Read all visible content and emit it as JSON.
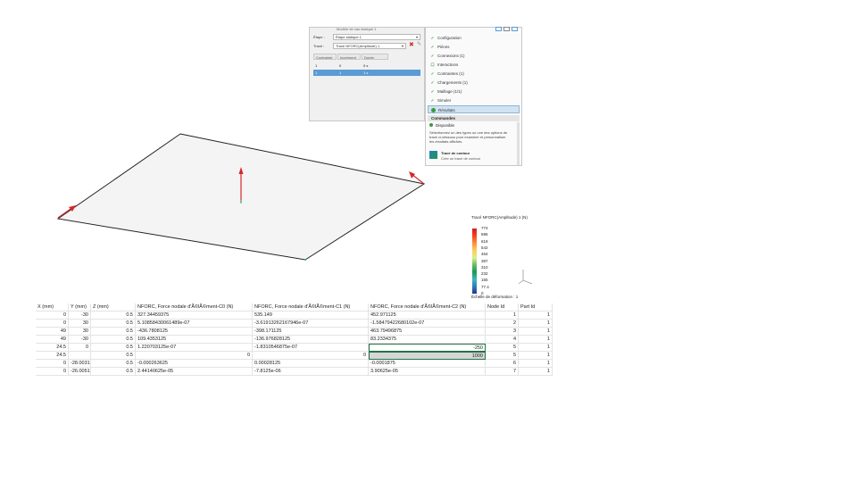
{
  "sim_panel": {
    "top_text": "Modèle de cas statique 1",
    "etape_label": "Étape :",
    "etape_value": "Étape statique 1",
    "trace_label": "Tracé :",
    "trace_value": "Tracé NFORC(Amplitude) 1",
    "col_headers": [
      "Contrainte",
      "Incrément",
      "Durée"
    ],
    "rows": [
      [
        "1",
        "0",
        "0 s"
      ],
      [
        "1",
        "1",
        "1 s"
      ]
    ]
  },
  "workflow": {
    "items": [
      {
        "label": "Configuration",
        "icon": "check-icon"
      },
      {
        "label": "Pièces",
        "icon": "check-icon"
      },
      {
        "label": "Connexions (1)",
        "icon": "check-icon"
      },
      {
        "label": "Interactions",
        "icon": "empty-box-icon"
      },
      {
        "label": "Contraintes (1)",
        "icon": "check-icon"
      },
      {
        "label": "Chargements (1)",
        "icon": "check-icon"
      },
      {
        "label": "Maillage (1/1)",
        "icon": "check-icon"
      },
      {
        "label": "Simuler",
        "icon": "check-icon"
      },
      {
        "label": "Résultats",
        "icon": "green-dot-icon"
      }
    ],
    "commands_header": "Commandes",
    "status": "Disponible",
    "description": "Sélectionnez un des types ou une des options de tracé ci-dessous pour examiner et personnaliser les résultats affichés.",
    "contour_title": "Tracé de contour",
    "contour_sub": "Crée un tracé de contour"
  },
  "legend": {
    "title": "Tracé NFORC(Amplitude) 1 (N)",
    "ticks": [
      "774",
      "696",
      "619",
      "542",
      "464",
      "387",
      "310",
      "232",
      "155",
      "77.4",
      "0"
    ],
    "footer": "Échelle de déformation : 1"
  },
  "sheet": {
    "headers": [
      "X (mm)",
      "Y (mm)",
      "Z (mm)",
      "NFORC, Force nodale d'Ã©lÃ©ment-C0 (N)",
      "NFORC, Force nodale d'Ã©lÃ©ment-C1 (N)",
      "NFORC, Force nodale d'Ã©lÃ©ment-C2 (N)",
      "Node Id",
      "Part Id"
    ],
    "rows": [
      [
        "0",
        "-30",
        "0.5",
        "327.34459375",
        "535.149",
        "452.971125",
        "1",
        "1"
      ],
      [
        "0",
        "30",
        "0.5",
        "5.10858430061489e-07",
        "-3.61913262167946e-07",
        "-1.58479422680102e-07",
        "2",
        "1"
      ],
      [
        "49",
        "30",
        "0.5",
        "-436.7808125",
        "-398.171125",
        "463.79496875",
        "3",
        "1"
      ],
      [
        "49",
        "-30",
        "0.5",
        "109.4353125",
        "-136.976828125",
        "83.2334375",
        "4",
        "1"
      ],
      [
        "24.5",
        "0",
        "0.5",
        "1.220703125e-07",
        "-1.8310546875e-07",
        "-250",
        "5",
        "1"
      ],
      [
        "24.5",
        "",
        "0.5",
        "0",
        "0",
        "1000",
        "5",
        "1"
      ],
      [
        "0",
        "-28.0031414",
        "0.5",
        "-0.000263625",
        "0.00028125",
        "-0.0001875",
        "6",
        "1"
      ],
      [
        "0",
        "-26.0051994",
        "0.5",
        "2.44140625e-05",
        "-7.8125e-06",
        "3.90625e-05",
        "7",
        "1"
      ]
    ]
  }
}
